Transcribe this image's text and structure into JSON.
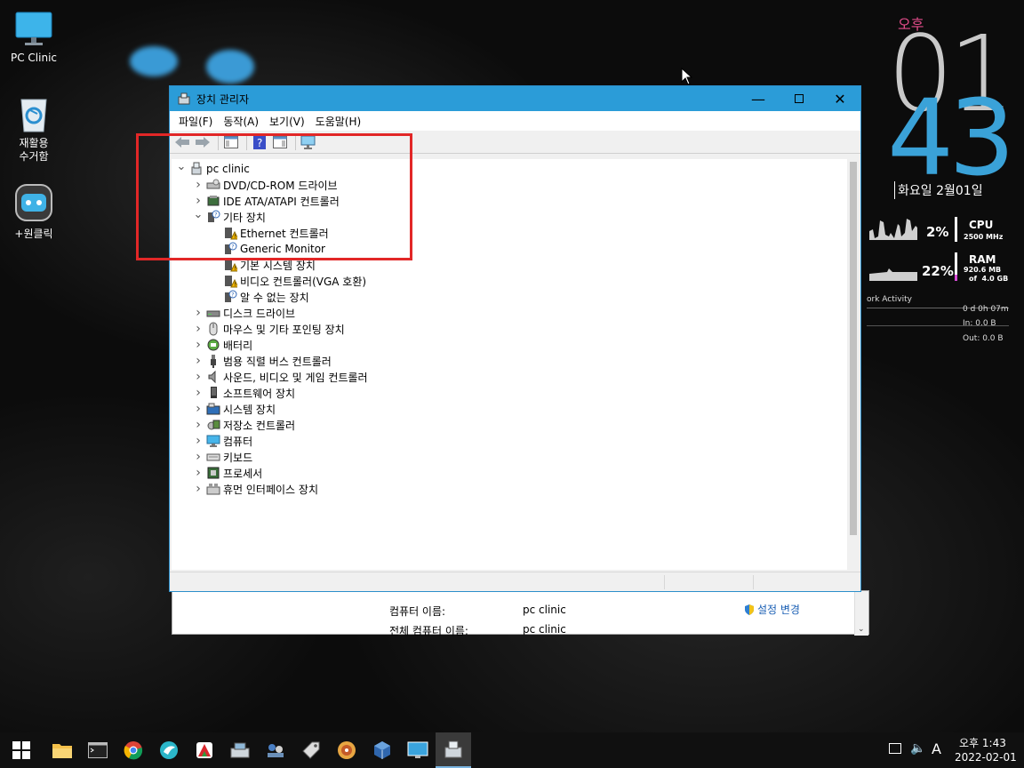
{
  "desktop": {
    "icons": [
      {
        "label": "PC Clinic"
      },
      {
        "label": "재활용\n수거함"
      },
      {
        "label": "+원클릭"
      }
    ]
  },
  "clock_widget": {
    "ampm": "오후",
    "hour": "01",
    "minute": "43",
    "date": "화요일 2월01일"
  },
  "sysmon": {
    "cpu_percent": "2%",
    "cpu_label": "CPU",
    "cpu_freq": "2500 MHz",
    "ram_percent": "22%",
    "ram_label": "RAM",
    "ram_used": "920.6 MB",
    "ram_total": "of  4.0 GB",
    "network_label": "ork Activity",
    "uptime": "0 d 0h 07m",
    "net_in": "In: 0.0 B",
    "net_out": "Out: 0.0 B"
  },
  "bg_window": {
    "row1_label": "컴퓨터 이름:",
    "row1_value": "pc clinic",
    "row2_label": "전체 컴퓨터 이름:",
    "row2_value": "pc clinic",
    "change_settings": "설정 변경"
  },
  "window": {
    "title": "장치 관리자",
    "menu": [
      "파일(F)",
      "동작(A)",
      "보기(V)",
      "도움말(H)"
    ],
    "tree": {
      "root": "pc clinic",
      "items": [
        {
          "label": "DVD/CD-ROM 드라이브"
        },
        {
          "label": "IDE ATA/ATAPI 컨트롤러"
        },
        {
          "label": "기타 장치"
        },
        {
          "label": "Ethernet 컨트롤러"
        },
        {
          "label": "Generic Monitor"
        },
        {
          "label": "기본 시스템 장치"
        },
        {
          "label": "비디오 컨트롤러(VGA 호환)"
        },
        {
          "label": "알 수 없는 장치"
        },
        {
          "label": "디스크 드라이브"
        },
        {
          "label": "마우스 및 기타 포인팅 장치"
        },
        {
          "label": "배터리"
        },
        {
          "label": "범용 직렬 버스 컨트롤러"
        },
        {
          "label": "사운드, 비디오 및 게임 컨트롤러"
        },
        {
          "label": "소프트웨어 장치"
        },
        {
          "label": "시스템 장치"
        },
        {
          "label": "저장소 컨트롤러"
        },
        {
          "label": "컴퓨터"
        },
        {
          "label": "키보드"
        },
        {
          "label": "프로세서"
        },
        {
          "label": "휴먼 인터페이스 장치"
        }
      ]
    }
  },
  "taskbar": {
    "tray_lang": "A",
    "time": "오후 1:43",
    "date": "2022-02-01"
  },
  "colors": {
    "title_bar": "#2b9cd8",
    "annotation_box": "#e22727",
    "clock_hour": "#c9c9c9",
    "clock_minute": "#3aa2d8",
    "clock_ampm": "#e24d8a"
  }
}
